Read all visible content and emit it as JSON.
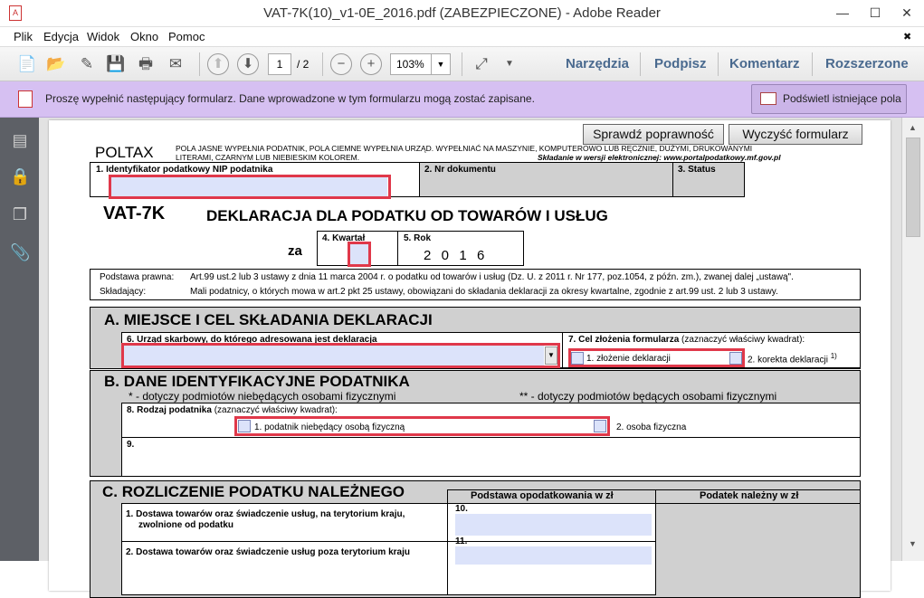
{
  "window": {
    "title": "VAT-7K(10)_v1-0E_2016.pdf (ZABEZPIECZONE) - Adobe Reader",
    "minimize": "—",
    "maximize": "☐",
    "close": "✕",
    "doc_close": "✖"
  },
  "menu": [
    "Plik",
    "Edycja",
    "Widok",
    "Okno",
    "Pomoc"
  ],
  "toolbar": {
    "page_current": "1",
    "page_total": "/ 2",
    "zoom": "103%",
    "links": [
      "Narzędzia",
      "Podpisz",
      "Komentarz",
      "Rozszerzone"
    ]
  },
  "notify": {
    "text": "Proszę wypełnić następujący formularz. Dane wprowadzone w tym formularzu mogą zostać zapisane.",
    "button": "Podświetl istniejące pola"
  },
  "form": {
    "btn_check": "Sprawdź poprawność",
    "btn_clear": "Wyczyść formularz",
    "poltax": "POLTAX",
    "header_note_1": "POLA JASNE WYPEŁNIA PODATNIK, POLA CIEMNE WYPEŁNIA URZĄD. WYPEŁNIAĆ NA MASZYNIE, KOMPUTEROWO LUB RĘCZNIE, DUŻYMI, DRUKOWANYMI",
    "header_note_2": "LITERAMI, CZARNYM LUB NIEBIESKIM KOLOREM.",
    "header_note_3": "Składanie w wersji elektronicznej: www.portalpodatkowy.mf.gov.pl",
    "f1": "1. Identyfikator podatkowy NIP podatnika",
    "f2": "2. Nr dokumentu",
    "f3": "3. Status",
    "code": "VAT-7K",
    "title": "DEKLARACJA DLA PODATKU OD TOWARÓW I USŁUG",
    "za": "za",
    "f4": "4. Kwartał",
    "f5": "5. Rok",
    "year": "2  0  1  6",
    "legal_label": "Podstawa prawna:",
    "legal_text": "Art.99 ust.2 lub 3 ustawy z dnia 11 marca 2004 r. o podatku od towarów i usług (Dz. U. z 2011 r. Nr 177, poz.1054, z późn. zm.), zwanej dalej „ustawą\".",
    "filer_label": "Składający:",
    "filer_text": "Mali podatnicy, o których mowa w art.2 pkt 25 ustawy, obowiązani do składania deklaracji za okresy kwartalne, zgodnie z art.99 ust. 2 lub 3 ustawy.",
    "secA": "A. MIEJSCE I CEL SKŁADANIA DEKLARACJI",
    "f6": "6. Urząd skarbowy, do którego adresowana jest deklaracja",
    "f7": "7. Cel złożenia formularza",
    "f7_hint": "(zaznaczyć właściwy kwadrat):",
    "opt1": "1. złożenie deklaracji",
    "opt2": "2. korekta deklaracji",
    "opt2_sup": "1)",
    "secB": "B. DANE IDENTYFIKACYJNE PODATNIKA",
    "noteB1": "* - dotyczy podmiotów niebędących osobami fizycznymi",
    "noteB2": "** - dotyczy podmiotów będących osobami fizycznymi",
    "f8": "8. Rodzaj podatnika",
    "f8_hint": "(zaznaczyć właściwy kwadrat):",
    "type1": "1. podatnik niebędący osobą fizyczną",
    "type2": "2. osoba fizyczna",
    "f9": "9.",
    "secC": "C. ROZLICZENIE PODATKU NALEŻNEGO",
    "colBase": "Podstawa opodatkowania w zł",
    "colTax": "Podatek należny  w zł",
    "row1": "1. Dostawa towarów oraz świadczenie usług, na terytorium kraju,",
    "row1b": "zwolnione od podatku",
    "row1n": "10.",
    "row2": "2. Dostawa towarów oraz świadczenie usług poza terytorium kraju",
    "row2n": "11."
  }
}
